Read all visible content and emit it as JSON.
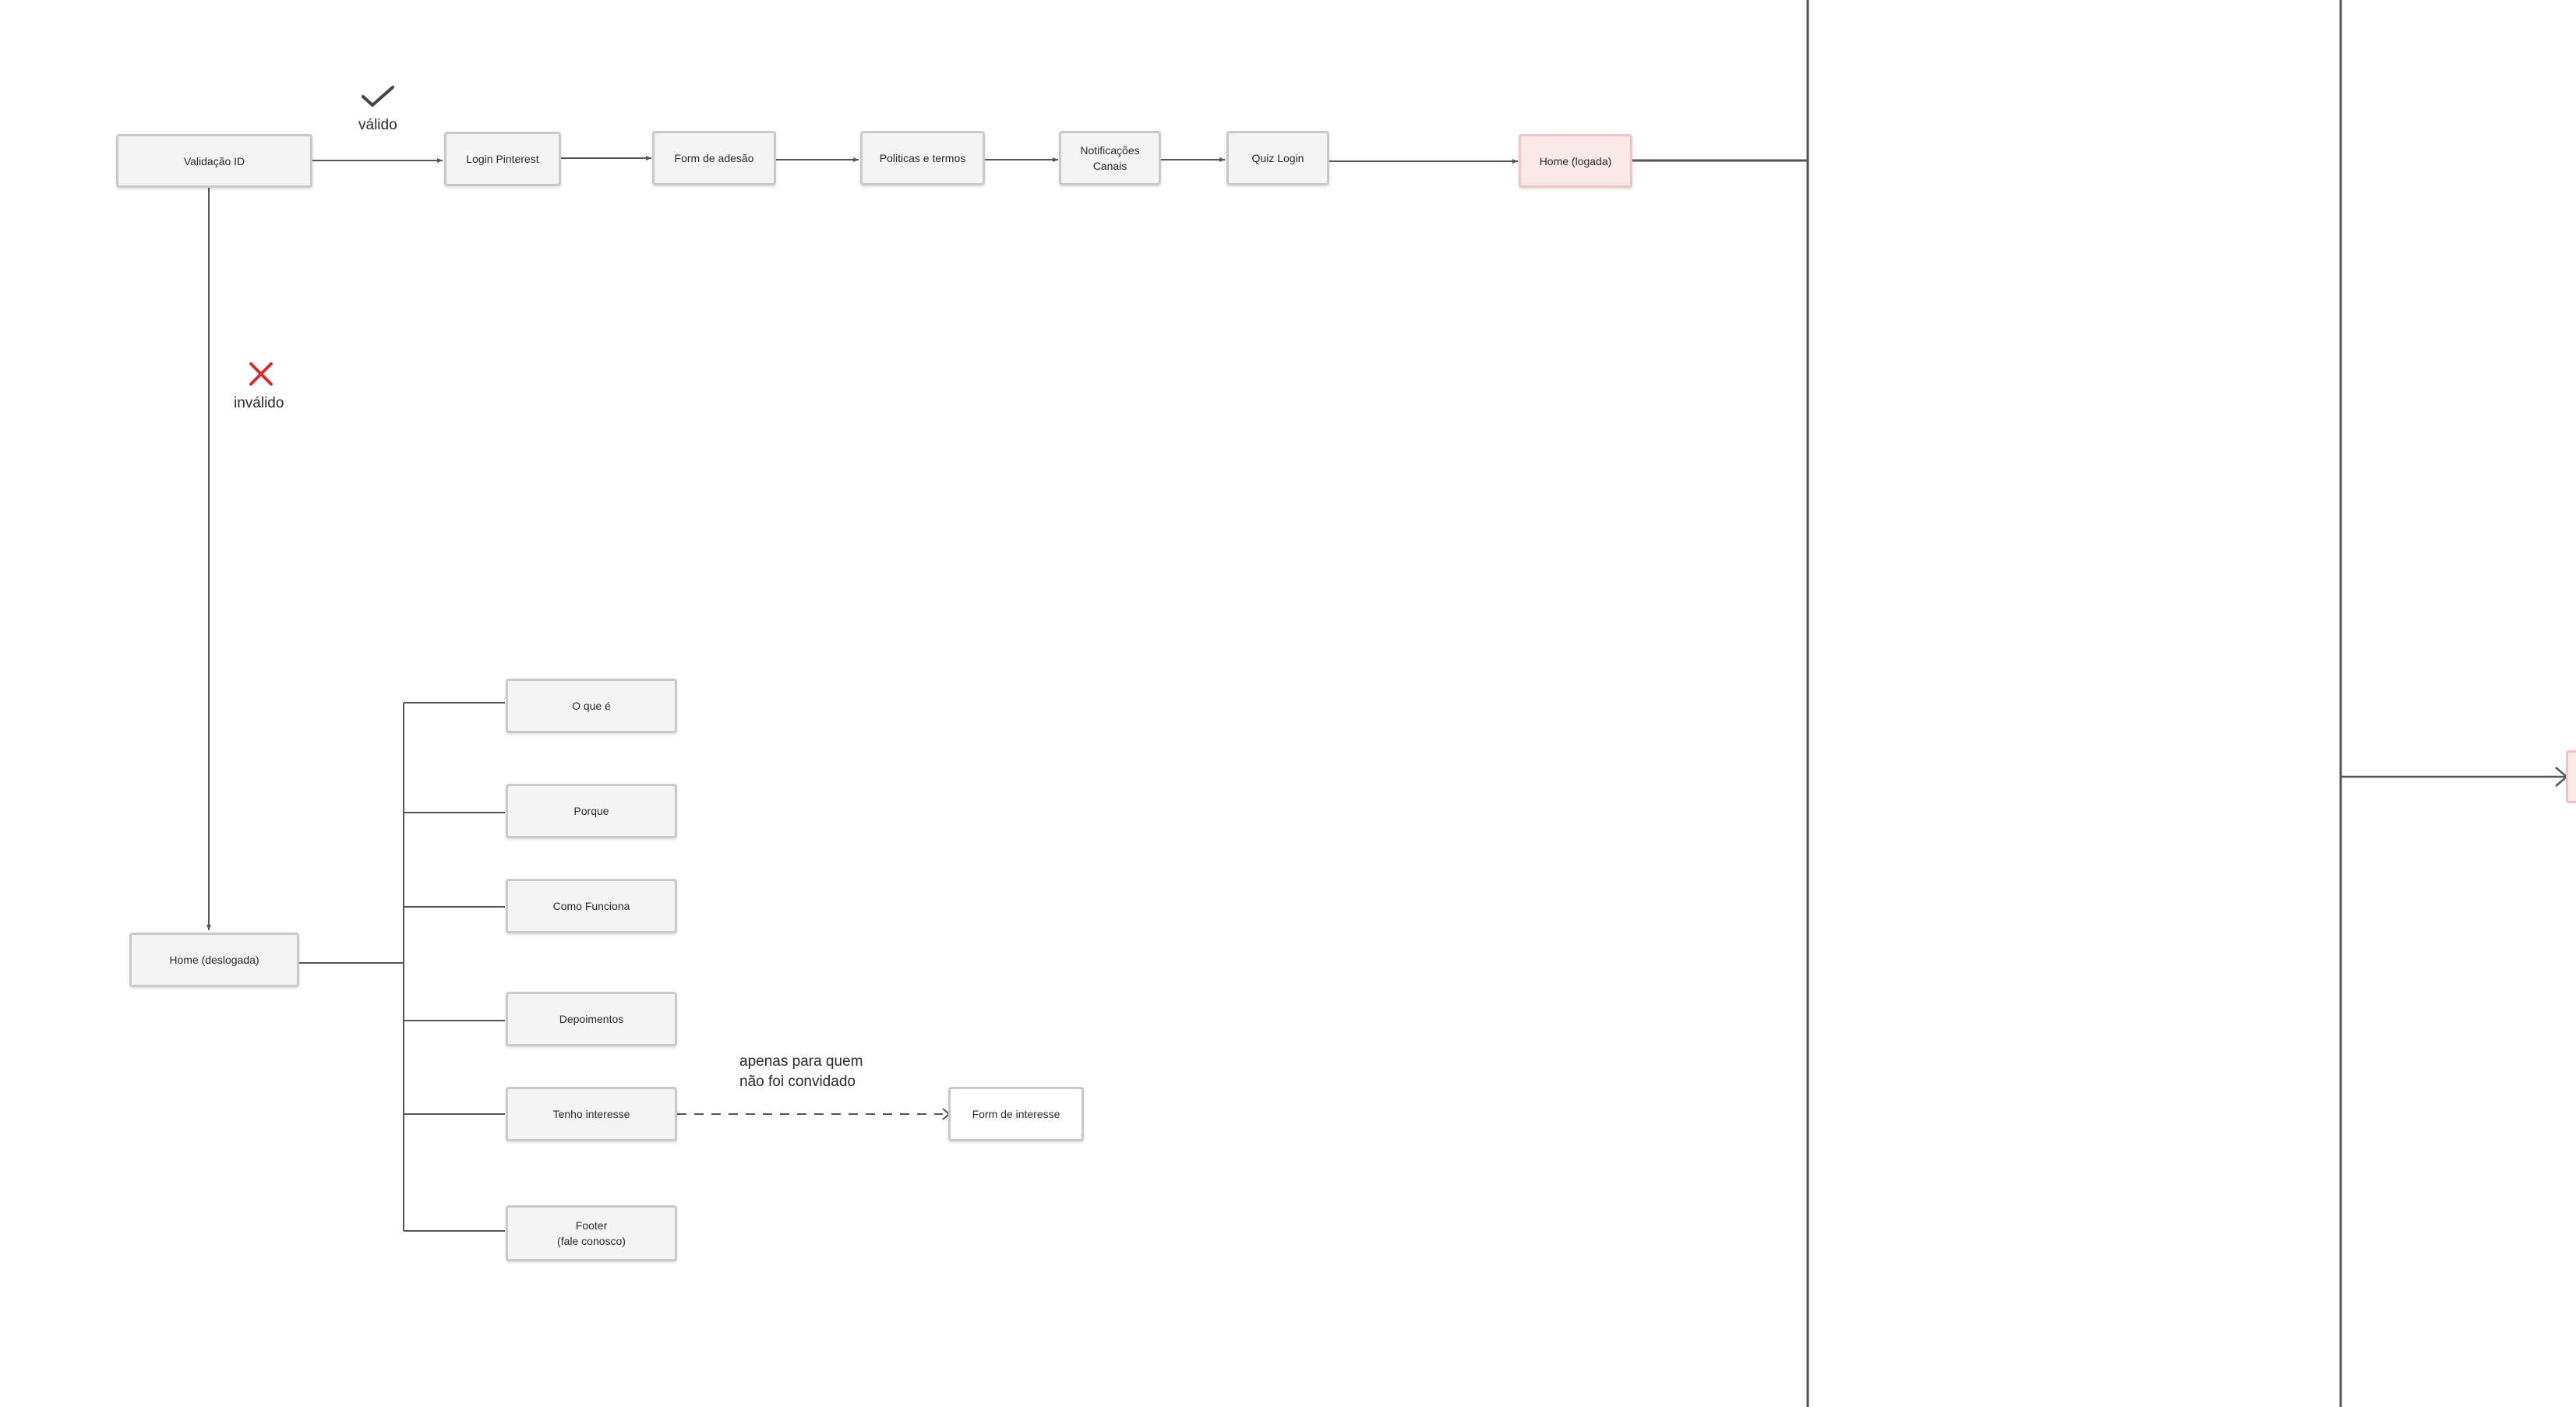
{
  "nodes": {
    "validacao_id": "Validação ID",
    "login_pinterest": "Login Pinterest",
    "form_adesao": "Form de adesão",
    "politicas_termos": "Politicas e termos",
    "notificacoes_canais": "Notificações\nCanais",
    "quiz_login": "Quiz Login",
    "home_logada": "Home (logada)",
    "home_deslogada": "Home (deslogada)",
    "o_que_e": "O que é",
    "porque": "Porque",
    "como_funciona": "Como Funciona",
    "depoimentos": "Depoimentos",
    "tenho_interesse": "Tenho interesse",
    "footer": "Footer\n(fale conosco)",
    "form_interesse": "Form de interesse"
  },
  "labels": {
    "valido": "válido",
    "invalido": "inválido",
    "apenas": "apenas para quem\nnão foi convidado"
  },
  "icons": {
    "valid": "checkmark-icon",
    "invalid": "x-icon"
  },
  "colors": {
    "line": "#555555",
    "node_border": "#c9c9c9",
    "node_fill": "#f4f4f4",
    "highlight_fill": "#fbe9ea",
    "highlight_border": "#efc4c7",
    "invalid_red": "#d62b2b"
  }
}
